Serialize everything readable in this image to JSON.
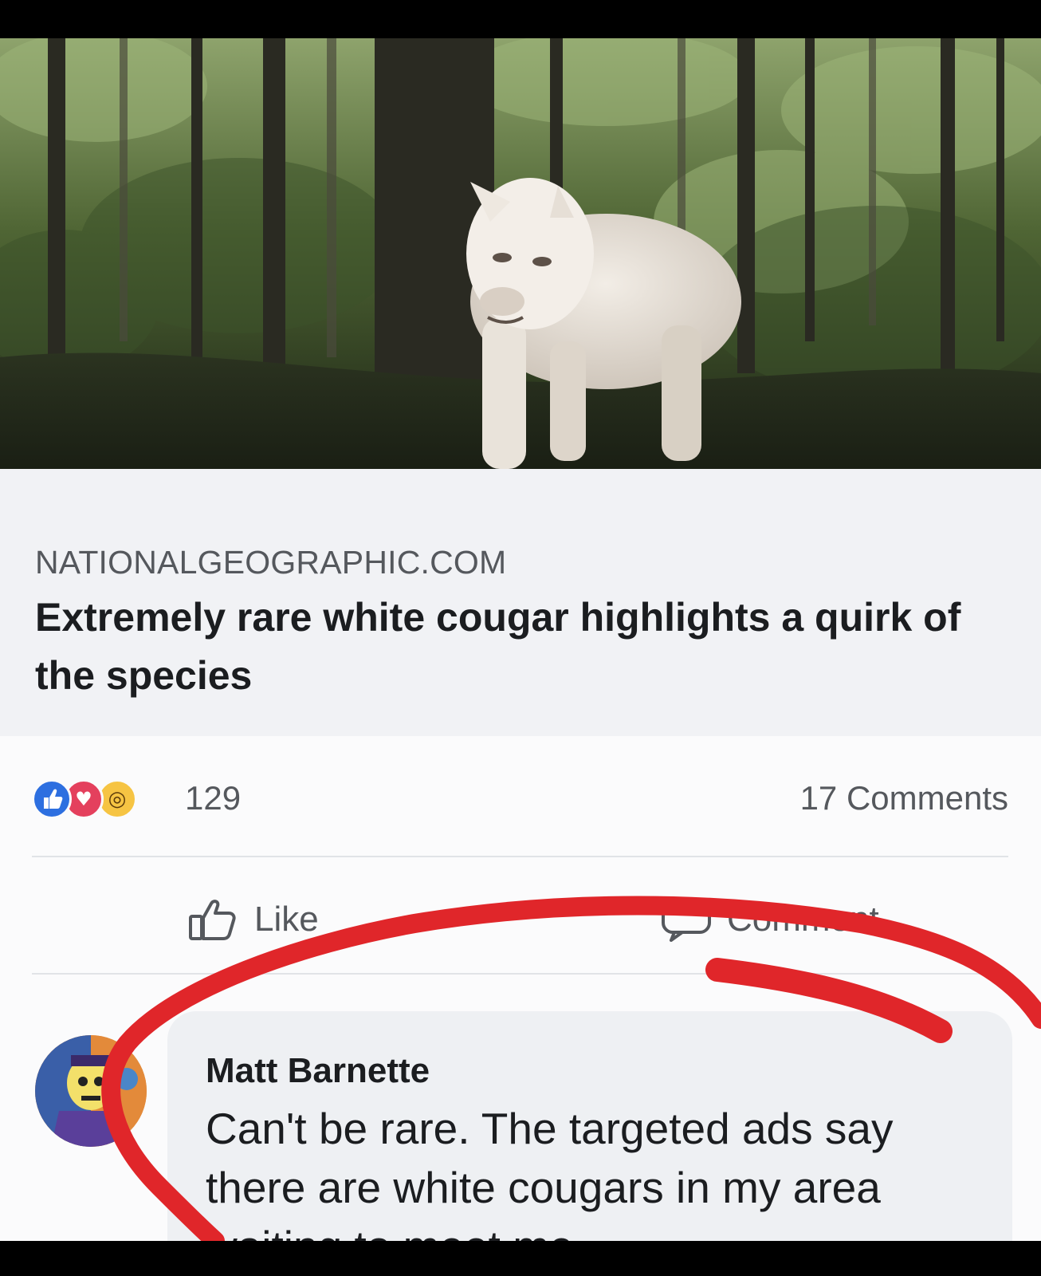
{
  "link": {
    "image_subject": "white cougar in forest",
    "domain": "NATIONALGEOGRAPHIC.COM",
    "title": "Extremely rare white cougar highlights a quirk of the species"
  },
  "post": {
    "reaction_count": "129",
    "comments_count": "17 Comments",
    "reactions": [
      "like-icon",
      "love-icon",
      "wow-icon"
    ],
    "actions": {
      "like_label": "Like",
      "comment_label": "Comment"
    }
  },
  "comment": {
    "author": "Matt Barnette",
    "text": "Can't be rare. The targeted ads say there are white cougars in my area waiting to meet me."
  },
  "colors": {
    "like_blue": "#2d6fe0",
    "love_red": "#e4405d",
    "wow_yellow": "#f6c443",
    "annotation_red": "#e0262a"
  }
}
